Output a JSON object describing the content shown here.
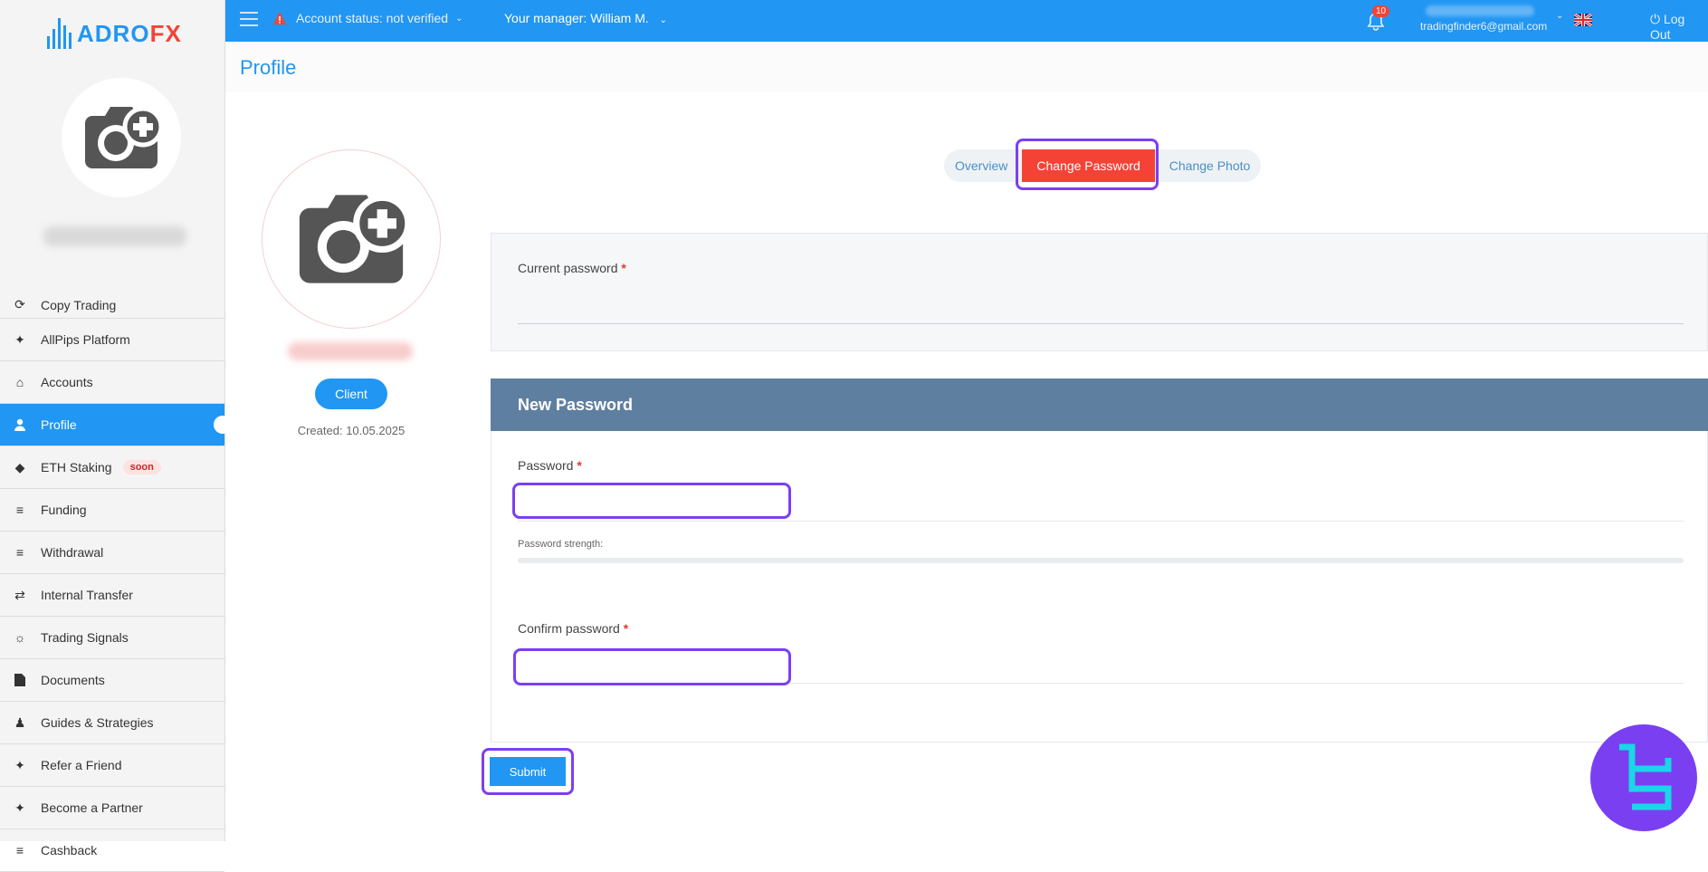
{
  "brand": {
    "logo_left": "ADRO",
    "logo_right": "FX"
  },
  "topbar": {
    "account_status": "Account status: not verified",
    "manager": "Your manager: William M.",
    "notifications_count": "10",
    "email": "tradingfinder6@gmail.com",
    "logout": "Log Out"
  },
  "sidebar": {
    "items": [
      {
        "label": "Copy Trading",
        "icon": "copy-trading-icon"
      },
      {
        "label": "AllPips Platform",
        "icon": "platform-icon"
      },
      {
        "label": "Accounts",
        "icon": "home-icon"
      },
      {
        "label": "Profile",
        "icon": "user-icon",
        "active": true
      },
      {
        "label": "ETH Staking",
        "icon": "ethereum-icon",
        "badge": "soon"
      },
      {
        "label": "Funding",
        "icon": "funding-icon"
      },
      {
        "label": "Withdrawal",
        "icon": "withdrawal-icon"
      },
      {
        "label": "Internal Transfer",
        "icon": "transfer-icon"
      },
      {
        "label": "Trading Signals",
        "icon": "signals-icon"
      },
      {
        "label": "Documents",
        "icon": "document-icon"
      },
      {
        "label": "Guides & Strategies",
        "icon": "guides-icon"
      },
      {
        "label": "Refer a Friend",
        "icon": "refer-icon"
      },
      {
        "label": "Become a Partner",
        "icon": "partner-icon"
      },
      {
        "label": "Cashback",
        "icon": "cashback-icon"
      }
    ]
  },
  "page": {
    "title": "Profile",
    "role_button": "Client",
    "created": "Created: 10.05.2025"
  },
  "tabs": [
    {
      "label": "Overview"
    },
    {
      "label": "Change Password",
      "active": true
    },
    {
      "label": "Change Photo"
    }
  ],
  "form": {
    "current_password_label": "Current password",
    "new_password_heading": "New Password",
    "password_label": "Password",
    "password_strength_label": "Password strength:",
    "confirm_password_label": "Confirm password",
    "required_mark": "*",
    "submit_label": "Submit"
  },
  "colors": {
    "primary": "#2196f3",
    "accent_red": "#f44336",
    "highlight": "#7b3ff2",
    "panel_header": "#5f7fa1"
  }
}
